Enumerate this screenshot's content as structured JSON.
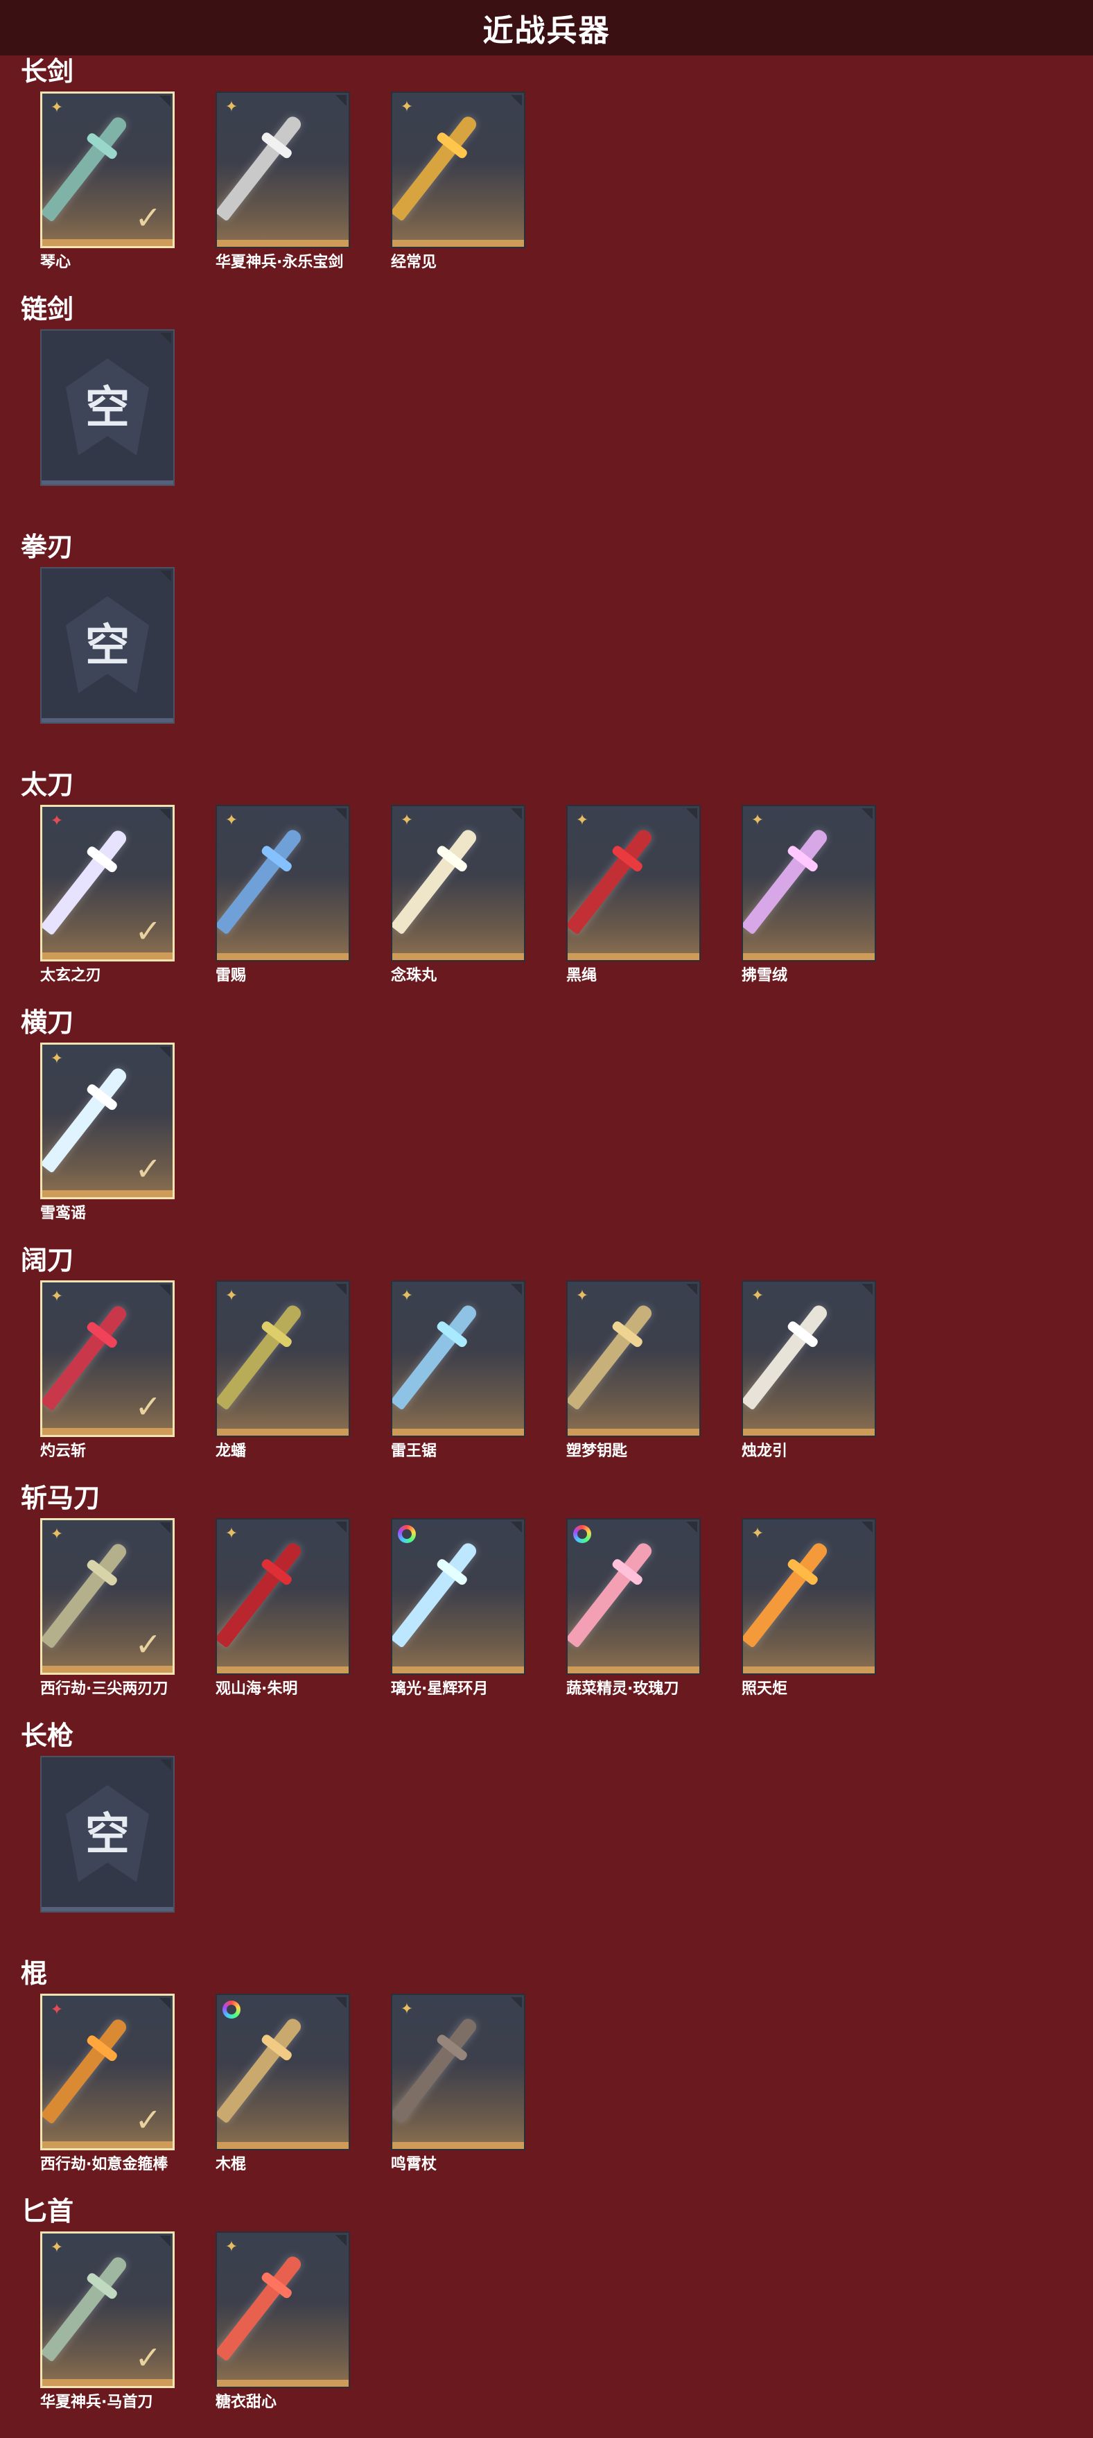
{
  "header": {
    "title": "近战兵器"
  },
  "empty_label": "空",
  "check_glyph": "✓",
  "categories": [
    {
      "title": "长剑",
      "items": [
        {
          "name": "琴心",
          "badge": "gold",
          "selected": true,
          "color": "#7fb3a8"
        },
        {
          "name": "华夏神兵·永乐宝剑",
          "badge": "gold",
          "selected": false,
          "color": "#c9c9c9"
        },
        {
          "name": "经常见",
          "badge": "gold",
          "selected": false,
          "color": "#d8a440"
        }
      ]
    },
    {
      "title": "链剑",
      "items": [
        {
          "empty": true
        }
      ]
    },
    {
      "title": "拳刃",
      "items": [
        {
          "empty": true
        }
      ]
    },
    {
      "title": "太刀",
      "items": [
        {
          "name": "太玄之刃",
          "badge": "red",
          "selected": true,
          "color": "#e7e3ff"
        },
        {
          "name": "雷赐",
          "badge": "gold",
          "selected": false,
          "color": "#6fa0d8"
        },
        {
          "name": "念珠丸",
          "badge": "gold",
          "selected": false,
          "color": "#efe6c9"
        },
        {
          "name": "黑绳",
          "badge": "gold",
          "selected": false,
          "color": "#c23035"
        },
        {
          "name": "拂雪绒",
          "badge": "gold",
          "selected": false,
          "color": "#d7a7e8"
        }
      ]
    },
    {
      "title": "横刀",
      "items": [
        {
          "name": "雪鸾谣",
          "badge": "gold",
          "selected": true,
          "color": "#dff4ff"
        }
      ]
    },
    {
      "title": "阔刀",
      "items": [
        {
          "name": "灼云斩",
          "badge": "gold",
          "selected": true,
          "color": "#c8384a"
        },
        {
          "name": "龙蟠",
          "badge": "gold",
          "selected": false,
          "color": "#b9ac58"
        },
        {
          "name": "雷王锯",
          "badge": "gold",
          "selected": false,
          "color": "#8ec3e6"
        },
        {
          "name": "塑梦钥匙",
          "badge": "gold",
          "selected": false,
          "color": "#c7b07a"
        },
        {
          "name": "烛龙引",
          "badge": "gold",
          "selected": false,
          "color": "#e8e3d9"
        }
      ]
    },
    {
      "title": "斩马刀",
      "items": [
        {
          "name": "西行劫·三尖两刃刀",
          "badge": "gold",
          "selected": true,
          "color": "#b4b08c"
        },
        {
          "name": "观山海·朱明",
          "badge": "gold",
          "selected": false,
          "color": "#b9262d"
        },
        {
          "name": "璃光·星辉环月",
          "badge": "rainbow",
          "selected": false,
          "color": "#bde6ff"
        },
        {
          "name": "蔬菜精灵·玫瑰刀",
          "badge": "rainbow",
          "selected": false,
          "color": "#f3a0b5"
        },
        {
          "name": "照天炬",
          "badge": "gold",
          "selected": false,
          "color": "#f59a3b"
        }
      ]
    },
    {
      "title": "长枪",
      "items": [
        {
          "empty": true
        }
      ]
    },
    {
      "title": "棍",
      "items": [
        {
          "name": "西行劫·如意金箍棒",
          "badge": "red",
          "selected": true,
          "color": "#d98a32"
        },
        {
          "name": "木棍",
          "badge": "rainbow",
          "selected": false,
          "color": "#c9a96e"
        },
        {
          "name": "鸣霄杖",
          "badge": "gold",
          "selected": false,
          "color": "#7d6f66"
        }
      ]
    },
    {
      "title": "匕首",
      "items": [
        {
          "name": "华夏神兵·马首刀",
          "badge": "gold",
          "selected": true,
          "color": "#9fb6a0"
        },
        {
          "name": "糖衣甜心",
          "badge": "gold",
          "selected": false,
          "color": "#e8614f"
        }
      ]
    }
  ]
}
